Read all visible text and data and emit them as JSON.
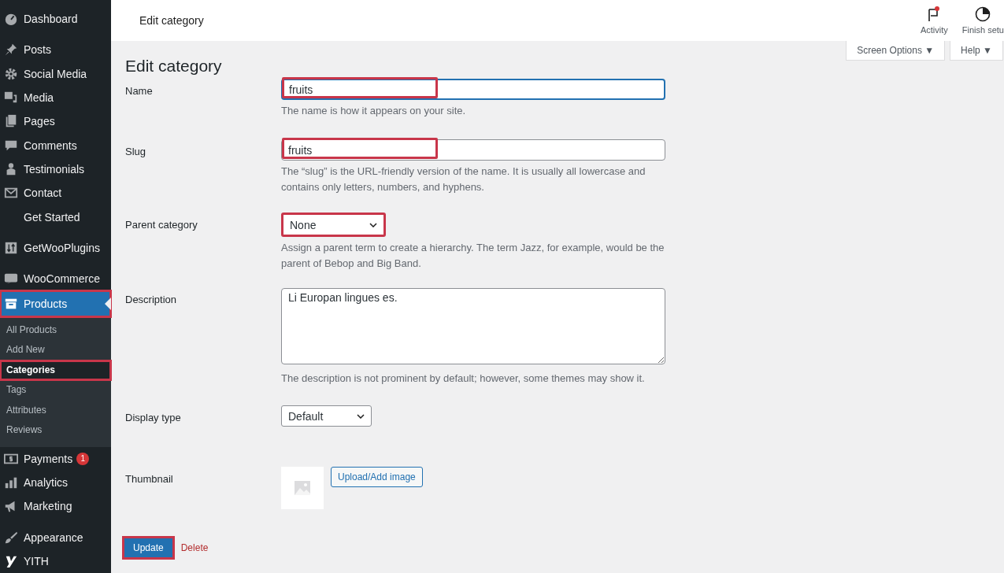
{
  "sidebar": {
    "items": [
      {
        "kind": "item",
        "label": "Dashboard",
        "selected": false
      },
      {
        "kind": "separator"
      },
      {
        "kind": "item",
        "label": "Posts",
        "selected": false
      },
      {
        "kind": "item",
        "label": "Social Media",
        "selected": false
      },
      {
        "kind": "item",
        "label": "Media",
        "selected": false
      },
      {
        "kind": "item",
        "label": "Pages",
        "selected": false
      },
      {
        "kind": "item",
        "label": "Comments",
        "selected": false
      },
      {
        "kind": "item",
        "label": "Testimonials",
        "selected": false
      },
      {
        "kind": "item",
        "label": "Contact",
        "selected": false
      },
      {
        "kind": "item",
        "label": "Get Started",
        "selected": false
      },
      {
        "kind": "separator"
      },
      {
        "kind": "item",
        "label": "GetWooPlugins",
        "selected": false
      },
      {
        "kind": "separator"
      },
      {
        "kind": "item",
        "label": "WooCommerce",
        "selected": false
      },
      {
        "kind": "item",
        "label": "Products",
        "selected": true,
        "highlighted": true,
        "children": [
          {
            "label": "All Products",
            "selected": false,
            "highlighted": false
          },
          {
            "label": "Add New",
            "selected": false,
            "highlighted": false
          },
          {
            "label": "Categories",
            "selected": true,
            "highlighted": true
          },
          {
            "label": "Tags",
            "selected": false,
            "highlighted": false
          },
          {
            "label": "Attributes",
            "selected": false,
            "highlighted": false
          },
          {
            "label": "Reviews",
            "selected": false,
            "highlighted": false
          }
        ]
      },
      {
        "kind": "item",
        "label": "Payments",
        "selected": false,
        "badge": "1"
      },
      {
        "kind": "item",
        "label": "Analytics",
        "selected": false
      },
      {
        "kind": "item",
        "label": "Marketing",
        "selected": false
      },
      {
        "kind": "separator"
      },
      {
        "kind": "item",
        "label": "Appearance",
        "selected": false
      },
      {
        "kind": "item",
        "label": "YITH",
        "selected": false
      }
    ]
  },
  "topbar": {
    "title": "Edit category",
    "actions": [
      {
        "label": "Activity",
        "notification": true
      },
      {
        "label": "Finish setu",
        "notification": false
      }
    ]
  },
  "screen_meta": [
    "Screen Options ▼",
    "Help ▼"
  ],
  "heading": "Edit category",
  "fields": [
    {
      "kind": "text",
      "label": "Name",
      "value": "fruits",
      "focused": true,
      "highlighted": true,
      "description": "The name is how it appears on your site."
    },
    {
      "kind": "text",
      "label": "Slug",
      "value": "fruits",
      "focused": false,
      "highlighted": true,
      "description": "The “slug” is the URL-friendly version of the name. It is usually all lowercase and contains only letters, numbers, and hyphens."
    },
    {
      "kind": "select",
      "label": "Parent category",
      "value": "None",
      "highlighted": true,
      "wide": true,
      "description": "Assign a parent term to create a hierarchy. The term Jazz, for example, would be the parent of Bebop and Big Band."
    },
    {
      "kind": "textarea",
      "label": "Description",
      "value": "Li Europan lingues es.",
      "description": "The description is not prominent by default; however, some themes may show it."
    },
    {
      "kind": "select",
      "label": "Display type",
      "value": "Default",
      "highlighted": false,
      "wide": false
    },
    {
      "kind": "thumbnail",
      "label": "Thumbnail",
      "button": "Upload/Add image"
    }
  ],
  "actions": {
    "update": {
      "label": "Update",
      "highlighted": true
    },
    "delete": "Delete"
  }
}
